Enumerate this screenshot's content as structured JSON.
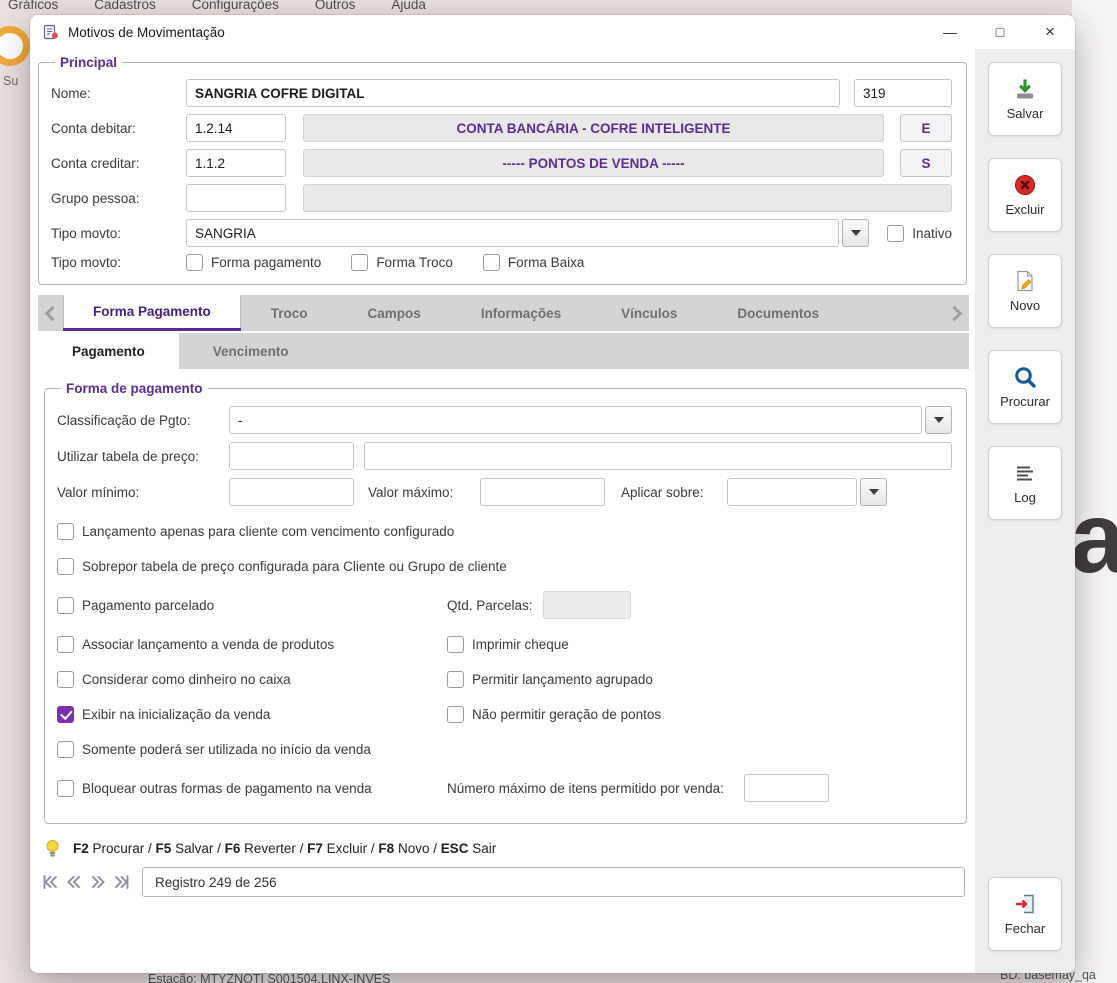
{
  "background": {
    "menu_items": [
      "Gráficos",
      "Cadastros",
      "Configurações",
      "Outros",
      "Ajuda"
    ],
    "partial_label": "Su",
    "station": "Estação: MTYZNOTI S001504.LINX-INVES",
    "database": "BD: basemay_qa",
    "watermark": "a"
  },
  "window": {
    "title": "Motivos de Movimentação",
    "minimize": "—",
    "maximize": "□",
    "close": "×"
  },
  "principal": {
    "legend": "Principal",
    "nome": {
      "label": "Nome:",
      "value": "SANGRIA COFRE DIGITAL",
      "code": "319"
    },
    "conta_debitar": {
      "label": "Conta debitar:",
      "code": "1.2.14",
      "desc": "CONTA BANCÁRIA - COFRE INTELIGENTE",
      "tag": "E"
    },
    "conta_creditar": {
      "label": "Conta creditar:",
      "code": "1.1.2",
      "desc": "----- PONTOS DE VENDA -----",
      "tag": "S"
    },
    "grupo_pessoa": {
      "label": "Grupo pessoa:",
      "code": "",
      "desc": ""
    },
    "tipo_movto": {
      "label": "Tipo movto:",
      "value": "SANGRIA",
      "inativo": {
        "label": "Inativo",
        "checked": false
      }
    },
    "tipo_movto_formas": {
      "label": "Tipo movto:",
      "options": [
        {
          "label": "Forma pagamento",
          "checked": false
        },
        {
          "label": "Forma Troco",
          "checked": false
        },
        {
          "label": "Forma Baixa",
          "checked": false
        }
      ]
    }
  },
  "tabs": {
    "items": [
      {
        "label": "Forma Pagamento",
        "active": true
      },
      {
        "label": "Troco",
        "active": false
      },
      {
        "label": "Campos",
        "active": false
      },
      {
        "label": "Informações",
        "active": false
      },
      {
        "label": "Vínculos",
        "active": false
      },
      {
        "label": "Documentos",
        "active": false
      }
    ]
  },
  "subtabs": {
    "items": [
      {
        "label": "Pagamento",
        "active": true
      },
      {
        "label": "Vencimento",
        "active": false
      }
    ]
  },
  "forma_pagamento": {
    "legend": "Forma de pagamento",
    "classificacao": {
      "label": "Classificação de Pgto:",
      "value": "-"
    },
    "tabela_preco": {
      "label": "Utilizar tabela de preço:",
      "code": "",
      "desc": ""
    },
    "valor_minimo": {
      "label": "Valor mínimo:",
      "value": ""
    },
    "valor_maximo": {
      "label": "Valor máximo:",
      "value": ""
    },
    "aplicar_sobre": {
      "label": "Aplicar sobre:",
      "value": ""
    },
    "checks_left": [
      {
        "label": "Lançamento apenas para cliente com vencimento configurado",
        "checked": false
      },
      {
        "label": "Sobrepor tabela de preço configurada para Cliente ou Grupo de cliente",
        "checked": false
      },
      {
        "label": "Pagamento parcelado",
        "checked": false
      },
      {
        "label": "Associar lançamento a venda de produtos",
        "checked": false
      },
      {
        "label": "Considerar como dinheiro no caixa",
        "checked": false
      },
      {
        "label": "Exibir na inicialização da venda",
        "checked": true
      },
      {
        "label": "Somente poderá ser utilizada no início da venda",
        "checked": false
      },
      {
        "label": "Bloquear outras formas de pagamento na venda",
        "checked": false
      }
    ],
    "checks_right": [
      {
        "label": "Imprimir cheque",
        "checked": false
      },
      {
        "label": "Permitir lançamento agrupado",
        "checked": false
      },
      {
        "label": "Não permitir geração de pontos",
        "checked": false
      }
    ],
    "qtd_parcelas": {
      "label": "Qtd. Parcelas:",
      "value": ""
    },
    "max_itens": {
      "label": "Número máximo de itens permitido por venda:",
      "value": ""
    }
  },
  "statusbar": {
    "segments": [
      {
        "key": "F2",
        "text": " Procurar / "
      },
      {
        "key": "F5",
        "text": " Salvar / "
      },
      {
        "key": "F6",
        "text": " Reverter / "
      },
      {
        "key": "F7",
        "text": " Excluir / "
      },
      {
        "key": "F8",
        "text": " Novo / "
      },
      {
        "key": "ESC",
        "text": " Sair"
      }
    ]
  },
  "record_nav": {
    "text": "Registro 249 de 256"
  },
  "toolbar": {
    "salvar": "Salvar",
    "excluir": "Excluir",
    "novo": "Novo",
    "procurar": "Procurar",
    "log": "Log",
    "fechar": "Fechar"
  },
  "colors": {
    "accent_purple": "#5C2D91",
    "checkbox_purple": "#7E2FB0"
  }
}
